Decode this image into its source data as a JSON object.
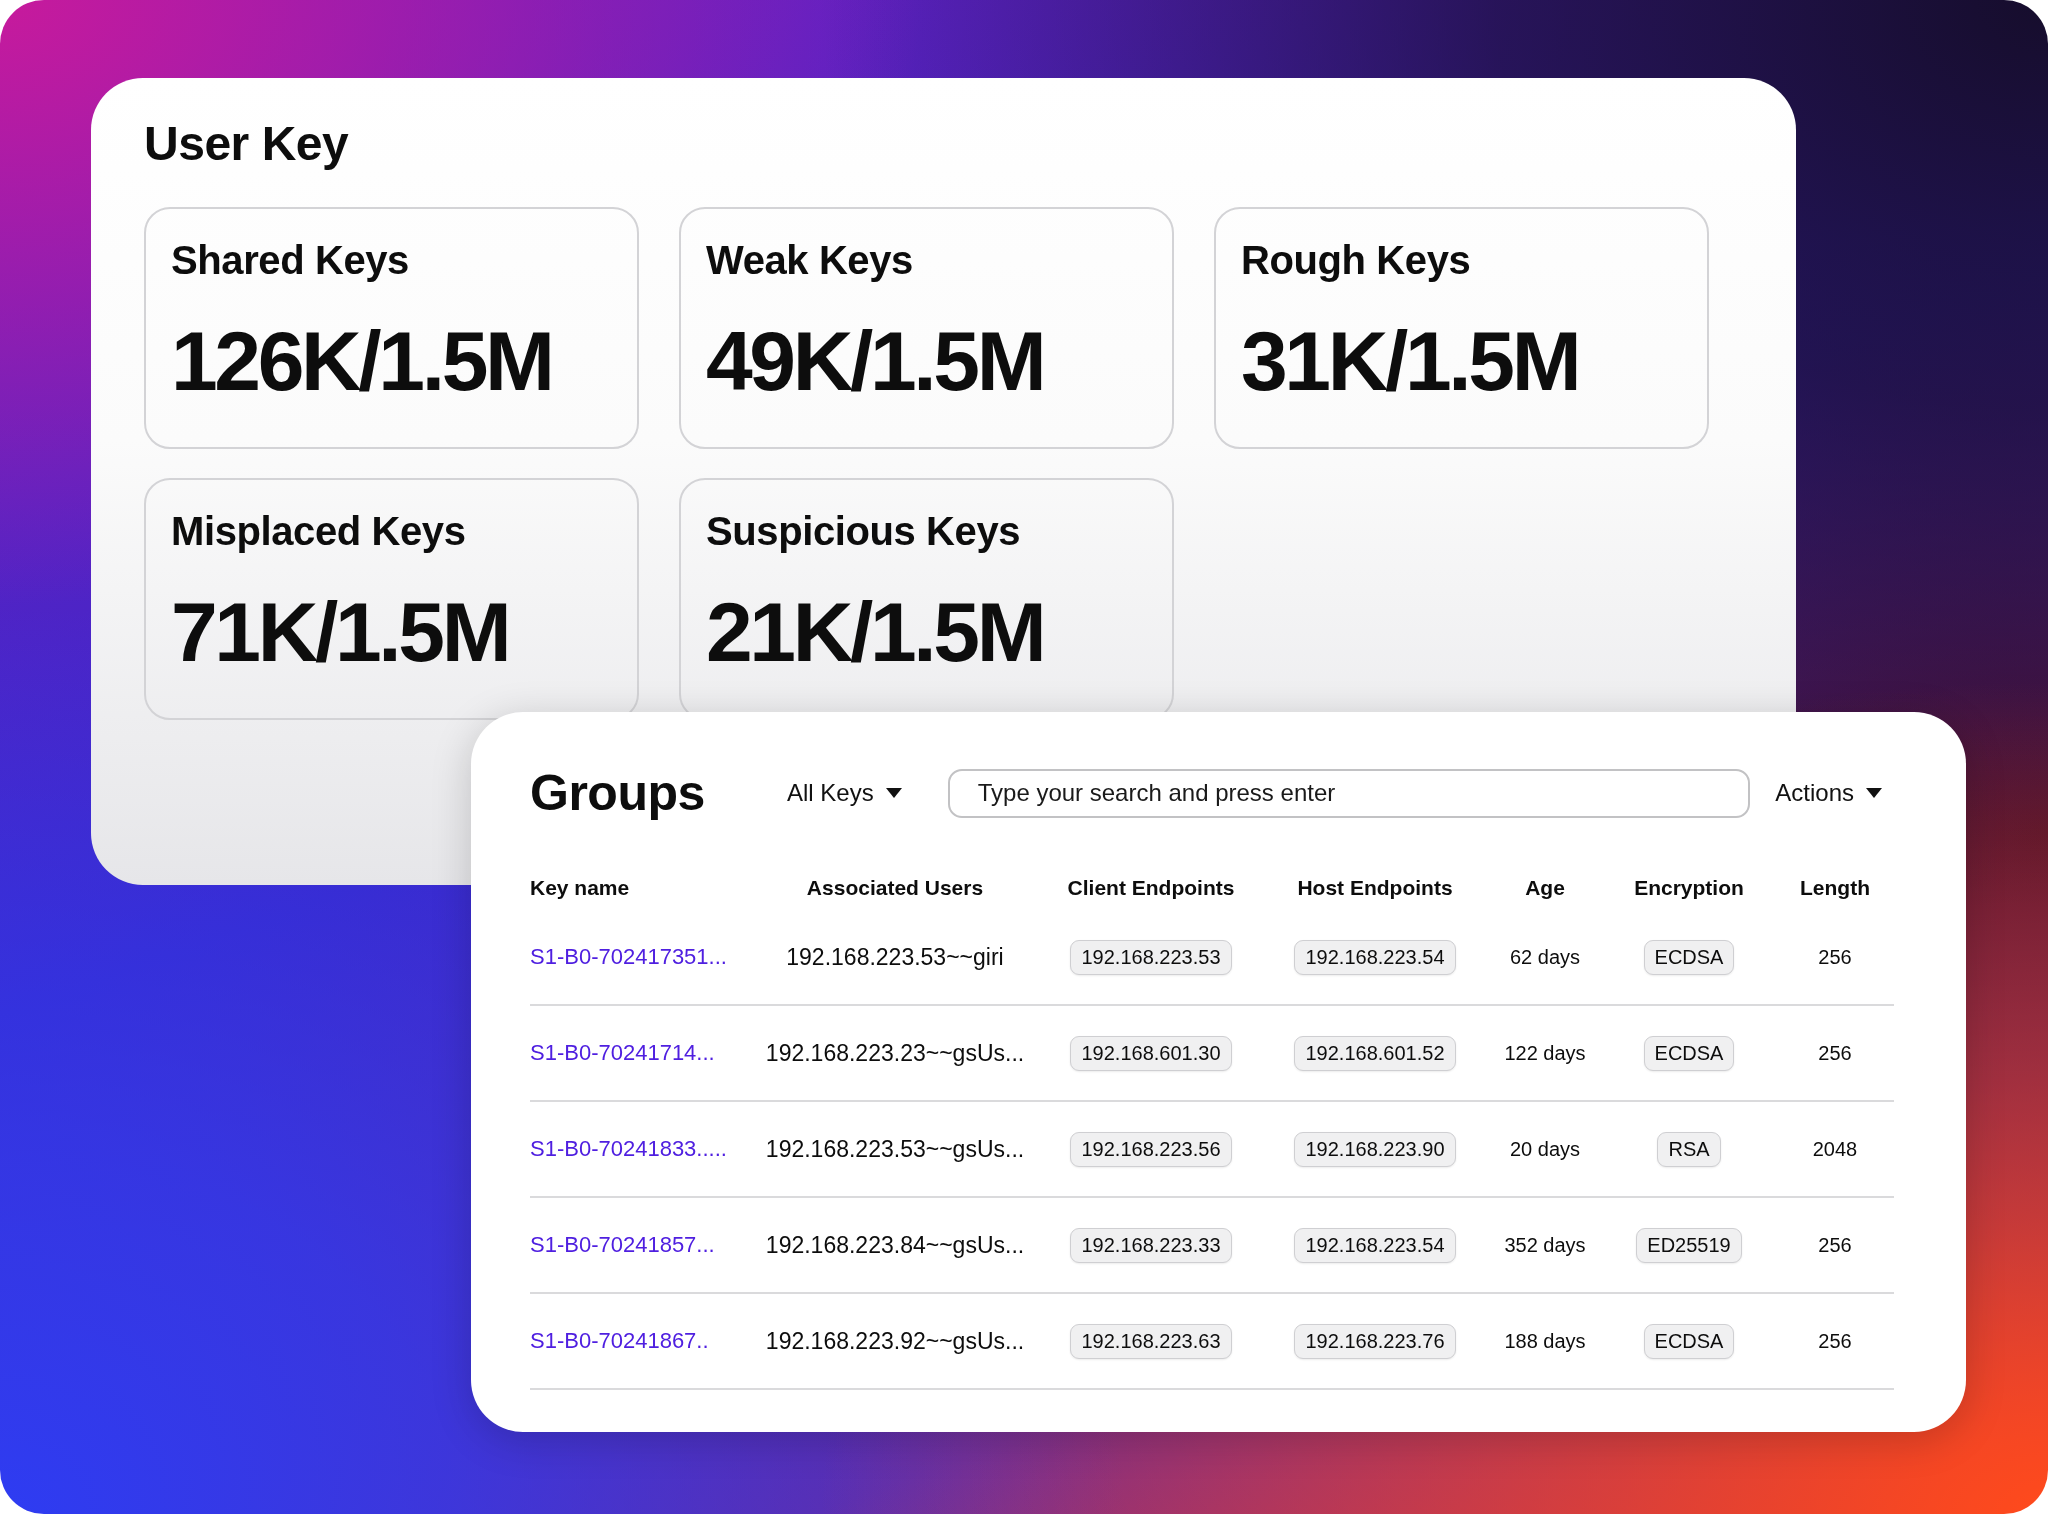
{
  "user_key": {
    "title": "User Key",
    "cards": [
      {
        "label": "Shared Keys",
        "value": "126K/1.5M"
      },
      {
        "label": "Weak Keys",
        "value": "49K/1.5M"
      },
      {
        "label": "Rough Keys",
        "value": "31K/1.5M"
      },
      {
        "label": "Misplaced Keys",
        "value": "71K/1.5M"
      },
      {
        "label": "Suspicious Keys",
        "value": "21K/1.5M"
      }
    ]
  },
  "groups": {
    "title": "Groups",
    "filter": {
      "label": "All Keys"
    },
    "search": {
      "placeholder": "Type your search and press enter"
    },
    "actions": {
      "label": "Actions"
    },
    "table": {
      "columns": [
        "Key name",
        "Associated Users",
        "Client Endpoints",
        "Host Endpoints",
        "Age",
        "Encryption",
        "Length"
      ],
      "rows": [
        {
          "key_name": "S1-B0-702417351...",
          "associated_users": "192.168.223.53~~giri",
          "client_endpoint": "192.168.223.53",
          "host_endpoint": "192.168.223.54",
          "age": "62 days",
          "encryption": "ECDSA",
          "length": "256"
        },
        {
          "key_name": "S1-B0-70241714...",
          "associated_users": "192.168.223.23~~gsUs...",
          "client_endpoint": "192.168.601.30",
          "host_endpoint": "192.168.601.52",
          "age": "122 days",
          "encryption": "ECDSA",
          "length": "256"
        },
        {
          "key_name": "S1-B0-70241833.....",
          "associated_users": "192.168.223.53~~gsUs...",
          "client_endpoint": "192.168.223.56",
          "host_endpoint": "192.168.223.90",
          "age": "20 days",
          "encryption": "RSA",
          "length": "2048"
        },
        {
          "key_name": "S1-B0-70241857...",
          "associated_users": "192.168.223.84~~gsUs...",
          "client_endpoint": "192.168.223.33",
          "host_endpoint": "192.168.223.54",
          "age": "352 days",
          "encryption": "ED25519",
          "length": "256"
        },
        {
          "key_name": "S1-B0-70241867..",
          "associated_users": "192.168.223.92~~gsUs...",
          "client_endpoint": "192.168.223.63",
          "host_endpoint": "192.168.223.76",
          "age": "188 days",
          "encryption": "ECDSA",
          "length": "256"
        }
      ]
    }
  }
}
